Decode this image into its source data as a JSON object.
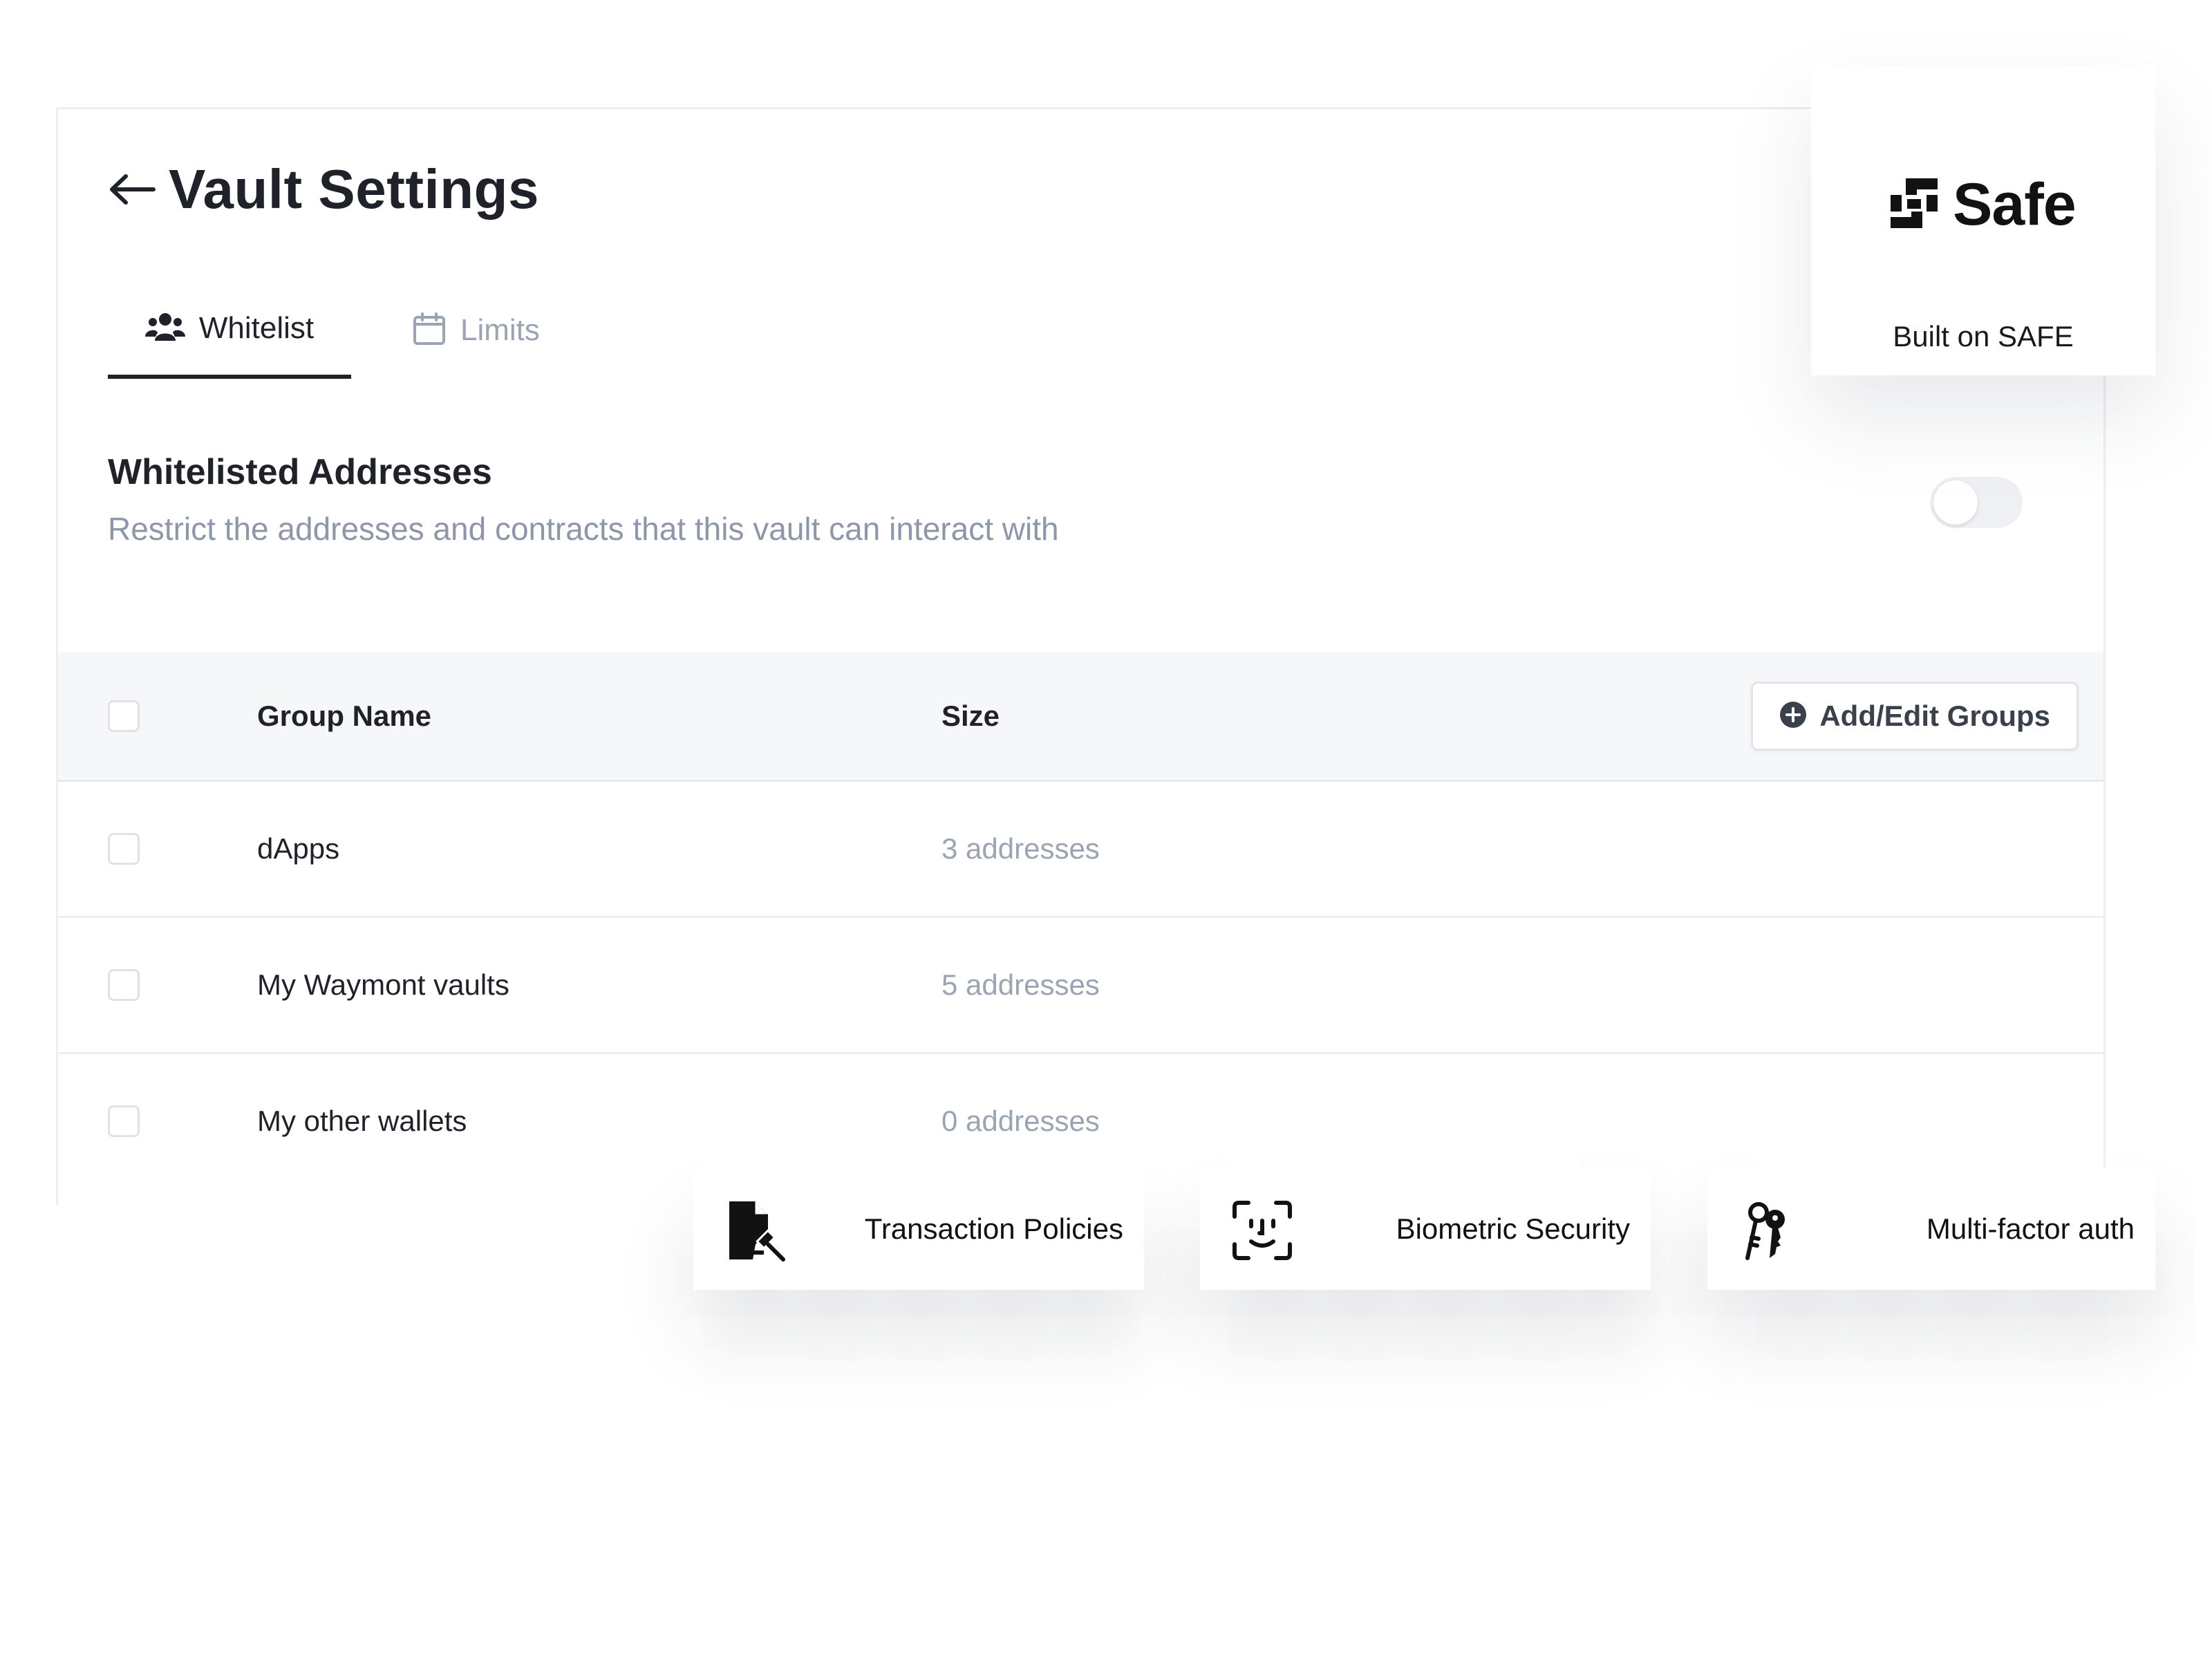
{
  "header": {
    "title": "Vault Settings"
  },
  "tabs": [
    {
      "label": "Whitelist",
      "icon": "users-icon",
      "active": true
    },
    {
      "label": "Limits",
      "icon": "calendar-icon",
      "active": false
    }
  ],
  "section": {
    "title": "Whitelisted Addresses",
    "subtitle": "Restrict the addresses and contracts that this vault can interact with",
    "toggle_on": false
  },
  "table": {
    "columns": [
      "Group Name",
      "Size"
    ],
    "action_label": "Add/Edit Groups",
    "rows": [
      {
        "name": "dApps",
        "size": "3 addresses"
      },
      {
        "name": "My Waymont vaults",
        "size": "5 addresses"
      },
      {
        "name": "My other wallets",
        "size": "0 addresses"
      }
    ]
  },
  "safe_card": {
    "wordmark": "Safe",
    "caption": "Built on SAFE"
  },
  "features": [
    {
      "label": "Transaction Policies",
      "icon": "document-gavel-icon"
    },
    {
      "label": "Biometric Security",
      "icon": "face-id-icon"
    },
    {
      "label": "Multi-factor auth",
      "icon": "keys-icon"
    }
  ],
  "colors": {
    "text_primary": "#1f2329",
    "text_muted": "#9aa4b2",
    "header_bg": "#f6f7f9",
    "border": "#eceef1"
  }
}
